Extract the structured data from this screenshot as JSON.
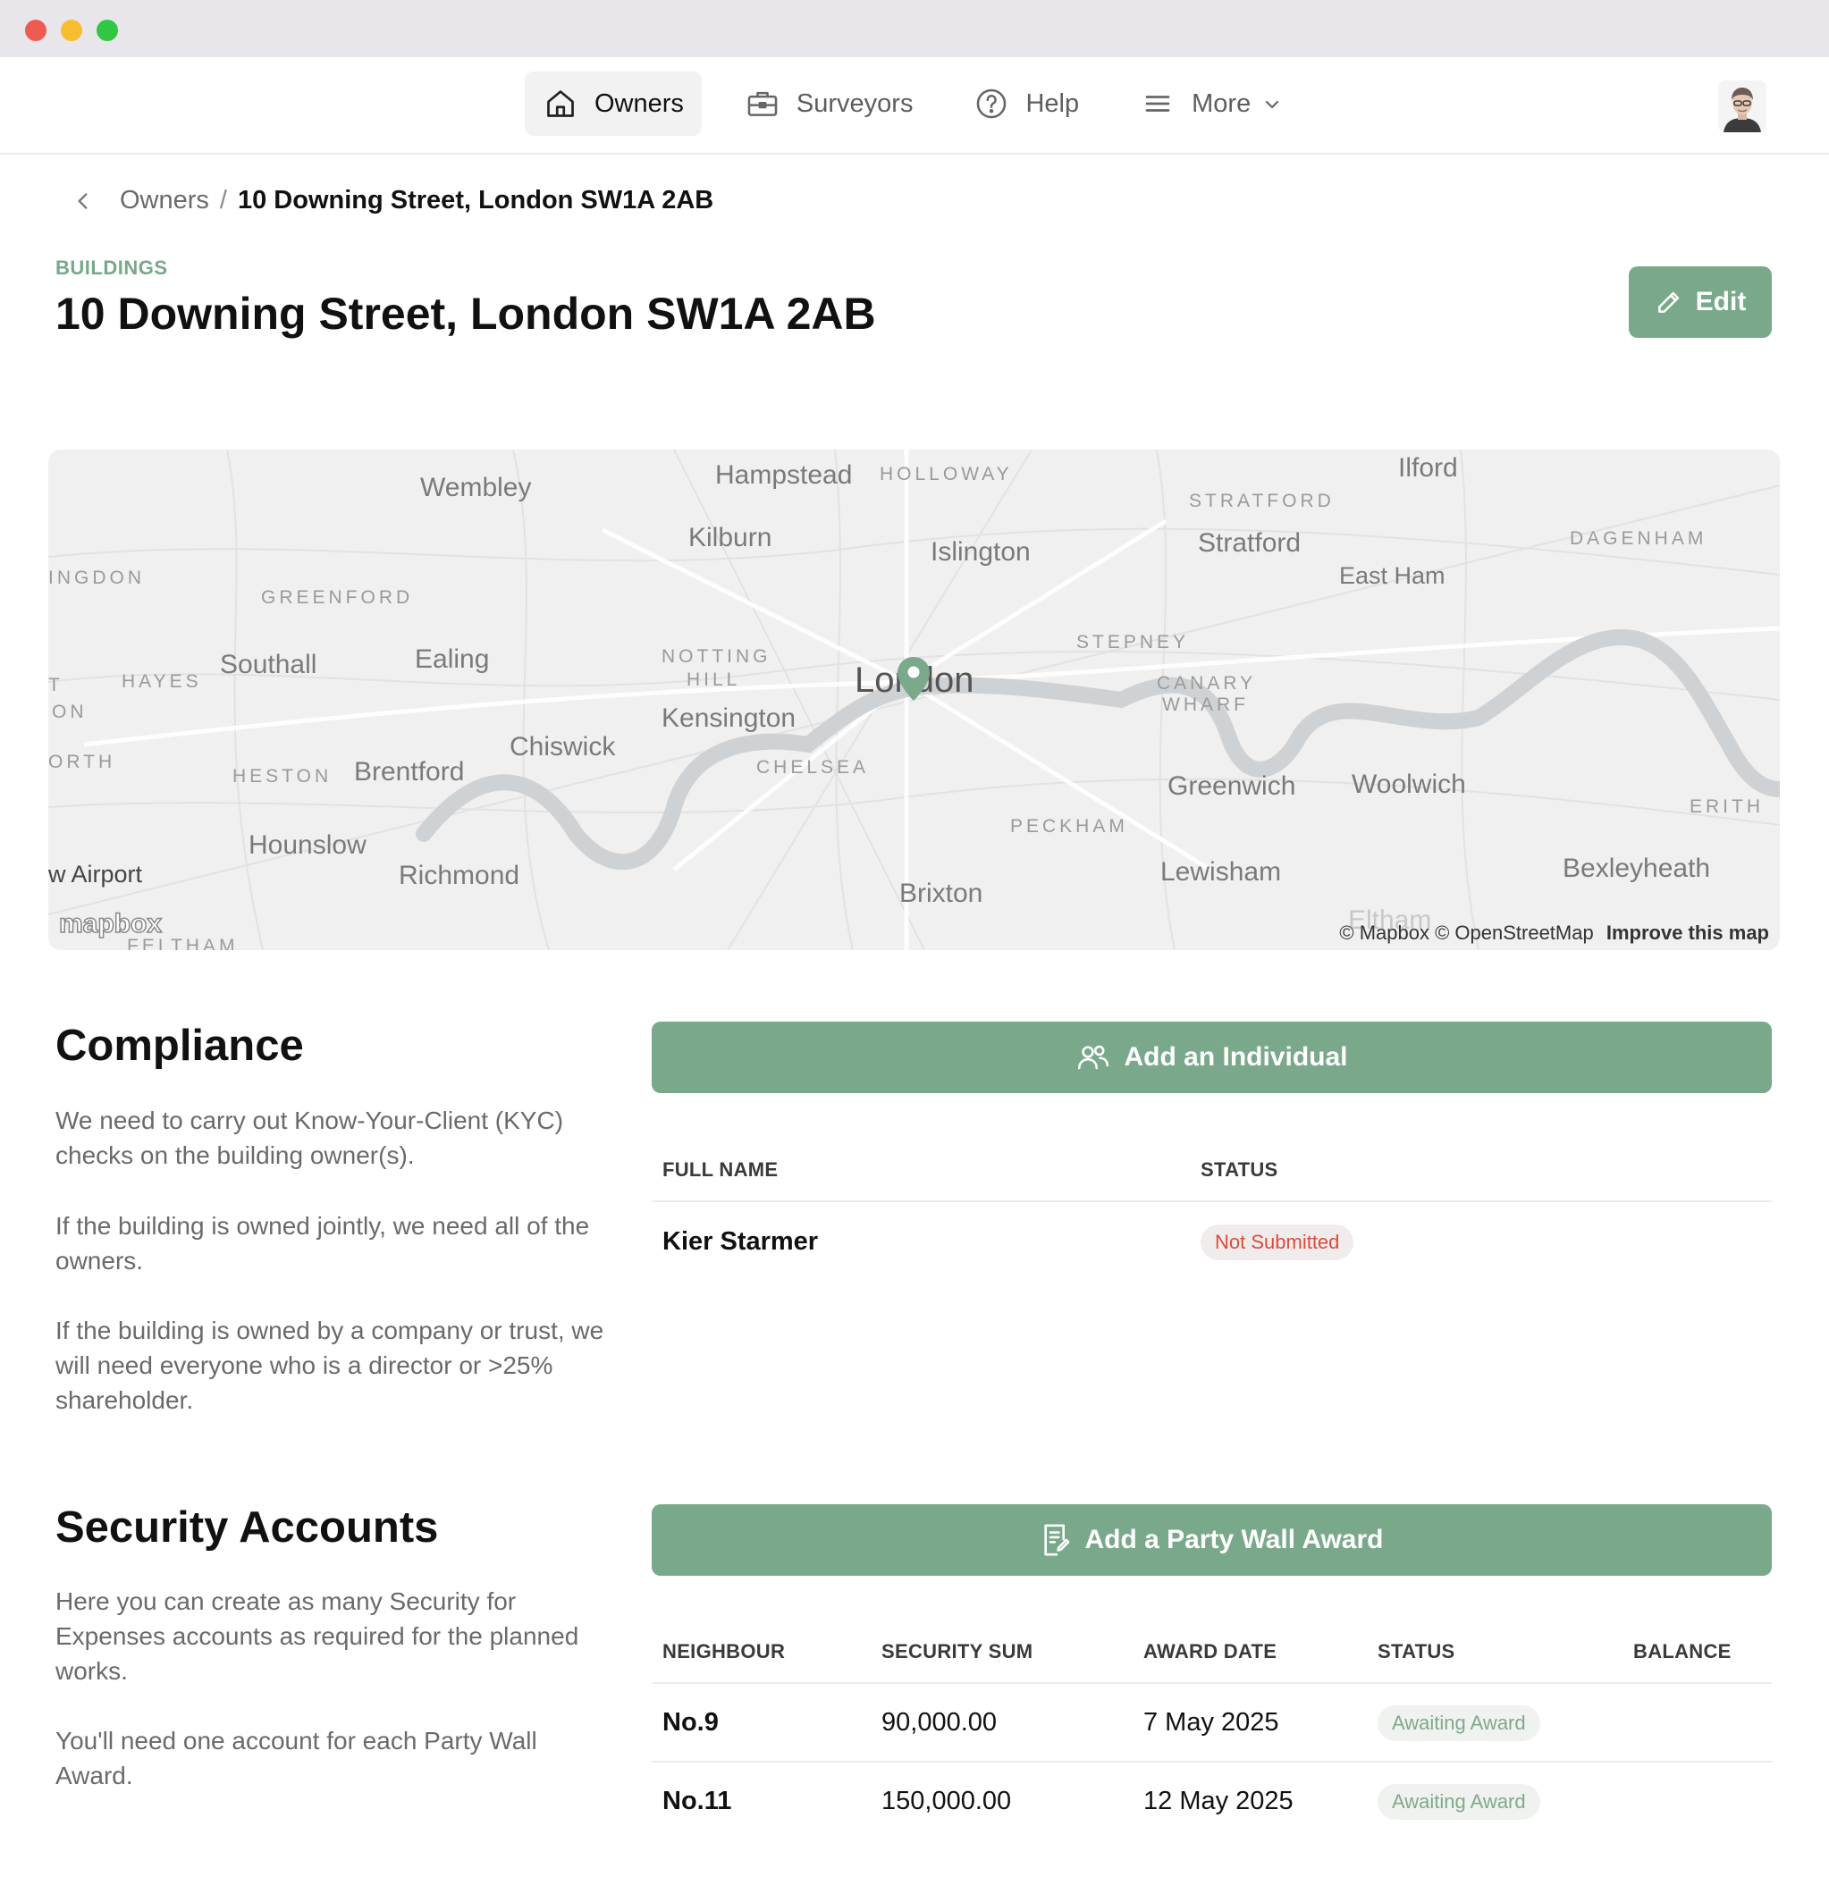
{
  "nav": {
    "items": [
      {
        "label": "Owners",
        "icon": "home-icon",
        "active": true
      },
      {
        "label": "Surveyors",
        "icon": "briefcase-icon",
        "active": false
      },
      {
        "label": "Help",
        "icon": "help-circle-icon",
        "active": false
      },
      {
        "label": "More",
        "icon": "menu-icon",
        "active": false
      }
    ]
  },
  "breadcrumb": {
    "parent": "Owners",
    "separator": "/",
    "current": "10 Downing Street, London SW1A 2AB"
  },
  "header": {
    "eyebrow": "BUILDINGS",
    "title": "10 Downing Street, London SW1A 2AB",
    "edit_label": "Edit"
  },
  "map": {
    "labels": {
      "wembley": "Wembley",
      "hampstead": "Hampstead",
      "holloway": "HOLLOWAY",
      "ilford": "Ilford",
      "kilburn": "Kilburn",
      "islington": "Islington",
      "stratford_caps": "STRATFORD",
      "stratford": "Stratford",
      "dagenham": "DAGENHAM",
      "ingdon": "INGDON",
      "greenford": "GREENFORD",
      "east_ham": "East Ham",
      "stepney": "STEPNEY",
      "southall": "Southall",
      "ealing": "Ealing",
      "notting": "NOTTING",
      "hill": "HILL",
      "hayes": "HAYES",
      "t": "T",
      "on": "ON",
      "london": "London",
      "canary": "CANARY",
      "wharf": "WHARF",
      "kensington": "Kensington",
      "chiswick": "Chiswick",
      "orth": "ORTH",
      "heston": "HESTON",
      "brentford": "Brentford",
      "chelsea": "CHELSEA",
      "greenwich": "Greenwich",
      "woolwich": "Woolwich",
      "erith": "ERITH",
      "peckham": "PECKHAM",
      "hounslow": "Hounslow",
      "airport": "w Airport",
      "richmond": "Richmond",
      "lewisham": "Lewisham",
      "bexleyheath": "Bexleyheath",
      "brixton": "Brixton",
      "eltham": "Eltham",
      "feltham": "FELTHAM"
    },
    "logo": "mapbox",
    "attribution": "© Mapbox © OpenStreetMap",
    "improve": "Improve this map"
  },
  "compliance": {
    "title": "Compliance",
    "paragraphs": [
      "We need to carry out Know-Your-Client (KYC) checks on the building owner(s).",
      "If the building is owned jointly, we need all of the owners.",
      "If the building is owned by a company or trust, we will need everyone who is a director or >25% shareholder."
    ],
    "button_label": "Add an Individual",
    "columns": [
      "FULL NAME",
      "STATUS"
    ],
    "rows": [
      {
        "name": "Kier Starmer",
        "status": "Not Submitted"
      }
    ]
  },
  "security": {
    "title": "Security Accounts",
    "paragraphs": [
      "Here you can create as many Security for Expenses accounts as required for the planned works.",
      "You'll need one account for each Party Wall Award."
    ],
    "button_label": "Add a Party Wall Award",
    "columns": [
      "NEIGHBOUR",
      "SECURITY SUM",
      "AWARD DATE",
      "STATUS",
      "BALANCE"
    ],
    "rows": [
      {
        "neighbour": "No.9",
        "sum": "90,000.00",
        "date": "7 May 2025",
        "status": "Awaiting Award",
        "balance": ""
      },
      {
        "neighbour": "No.11",
        "sum": "150,000.00",
        "date": "12 May 2025",
        "status": "Awaiting Award",
        "balance": ""
      }
    ]
  },
  "colors": {
    "accent": "#79a98a",
    "eyebrow": "#78a889",
    "danger": "#dc4a3c"
  }
}
